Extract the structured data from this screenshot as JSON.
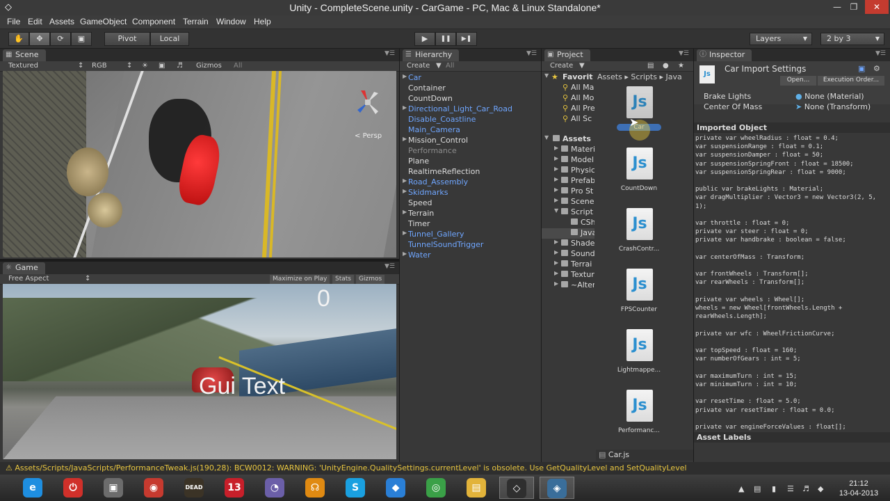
{
  "window": {
    "title": "Unity - CompleteScene.unity - CarGame - PC, Mac & Linux Standalone*",
    "controls": {
      "minimize": "—",
      "maximize": "❐",
      "close": "✕"
    }
  },
  "menu": [
    "File",
    "Edit",
    "Assets",
    "GameObject",
    "Component",
    "Terrain",
    "Window",
    "Help"
  ],
  "toolbar": {
    "transform_tools": [
      "hand-icon",
      "move-icon",
      "rotate-icon",
      "scale-icon"
    ],
    "pivot_label": "Pivot",
    "local_label": "Local",
    "play": "▶",
    "pause": "❚❚",
    "step": "▶❚",
    "layers_label": "Layers",
    "layout_label": "2 by 3"
  },
  "scene": {
    "tab_label": "Scene",
    "render_mode": "Textured",
    "color_mode": "RGB",
    "gizmos_label": "Gizmos",
    "search_placeholder": "All",
    "persp_label": "Persp"
  },
  "game": {
    "tab_label": "Game",
    "aspect": "Free Aspect",
    "maximize_label": "Maximize on Play",
    "stats_label": "Stats",
    "gizmos_label": "Gizmos",
    "score": "0",
    "gui_text": "Gui Text",
    "car_label": "Gui Text"
  },
  "hierarchy": {
    "tab_label": "Hierarchy",
    "create_label": "Create",
    "search_placeholder": "All",
    "items": [
      {
        "label": "Car",
        "kind": "prefab",
        "expandable": true
      },
      {
        "label": "Container",
        "kind": "normal",
        "expandable": false
      },
      {
        "label": "CountDown",
        "kind": "normal",
        "expandable": false
      },
      {
        "label": "Directional_Light_Car_Road",
        "kind": "prefab",
        "expandable": true
      },
      {
        "label": "Disable_Coastline",
        "kind": "prefab",
        "expandable": false
      },
      {
        "label": "Main_Camera",
        "kind": "prefab",
        "expandable": false
      },
      {
        "label": "Mission_Control",
        "kind": "normal",
        "expandable": true
      },
      {
        "label": "Performance",
        "kind": "dim",
        "expandable": false
      },
      {
        "label": "Plane",
        "kind": "normal",
        "expandable": false
      },
      {
        "label": "RealtimeReflection",
        "kind": "normal",
        "expandable": false
      },
      {
        "label": "Road_Assembly",
        "kind": "prefab",
        "expandable": true
      },
      {
        "label": "Skidmarks",
        "kind": "prefab",
        "expandable": true
      },
      {
        "label": "Speed",
        "kind": "normal",
        "expandable": false
      },
      {
        "label": "Terrain",
        "kind": "normal",
        "expandable": true
      },
      {
        "label": "Timer",
        "kind": "normal",
        "expandable": false
      },
      {
        "label": "Tunnel_Gallery",
        "kind": "prefab",
        "expandable": true
      },
      {
        "label": "TunnelSoundTrigger",
        "kind": "prefab",
        "expandable": false
      },
      {
        "label": "Water",
        "kind": "prefab",
        "expandable": true
      }
    ]
  },
  "project": {
    "tab_label": "Project",
    "create_label": "Create",
    "favorites_label": "Favorit",
    "favorites": [
      "All Ma",
      "All Mo",
      "All Pre",
      "All Sc"
    ],
    "assets_label": "Assets",
    "folders": [
      "Materi",
      "Model",
      "Physic",
      "Prefab",
      "Pro St",
      "Scene",
      "Script",
      "CSh",
      "Java",
      "Shade",
      "Sound",
      "Terrai",
      "Textur",
      "~Alter"
    ],
    "breadcrumb": [
      "Assets",
      "Scripts",
      "Java"
    ],
    "breadcrumb_sep": "▸",
    "assets": [
      "Car",
      "CountDown",
      "CrashContr...",
      "FPSCounter",
      "Lightmappe...",
      "Performanc..."
    ],
    "js_glyph": "Js",
    "selected_file": "Car.js"
  },
  "inspector": {
    "tab_label": "Inspector",
    "title": "Car Import Settings",
    "open_label": "Open...",
    "exec_order_label": "Execution Order...",
    "fields": [
      {
        "label": "Brake Lights",
        "value": "None (Material)"
      },
      {
        "label": "Center Of Mass",
        "value": "None (Transform)"
      }
    ],
    "imported_label": "Imported Object",
    "code": "private var wheelRadius : float = 0.4;\nvar suspensionRange : float = 0.1;\nvar suspensionDamper : float = 50;\nvar suspensionSpringFront : float = 18500;\nvar suspensionSpringRear : float = 9000;\n\npublic var brakeLights : Material;\nvar dragMultiplier : Vector3 = new Vector3(2, 5, 1);\n\nvar throttle : float = 0;\nprivate var steer : float = 0;\nprivate var handbrake : boolean = false;\n\nvar centerOfMass : Transform;\n\nvar frontWheels : Transform[];\nvar rearWheels : Transform[];\n\nprivate var wheels : Wheel[];\nwheels = new Wheel[frontWheels.Length + rearWheels.Length];\n\nprivate var wfc : WheelFrictionCurve;\n\nvar topSpeed : float = 160;\nvar numberOfGears : int = 5;\n\nvar maximumTurn : int = 15;\nvar minimumTurn : int = 10;\n\nvar resetTime : float = 5.0;\nprivate var resetTimer : float = 0.0;\n\nprivate var engineForceValues : float[];",
    "asset_labels": "Asset Labels"
  },
  "status": {
    "message": "Assets/Scripts/JavaScripts/PerformanceTweak.js(190,28): BCW0012: WARNING: 'UnityEngine.QualitySettings.currentLevel' is obsolete. Use GetQualityLevel and SetQualityLevel"
  },
  "taskbar": {
    "apps": [
      {
        "name": "internet-explorer-icon",
        "glyph": "e",
        "color": "#1e8ee0"
      },
      {
        "name": "shutdown-app-icon",
        "glyph": "⏻",
        "color": "#d0302a"
      },
      {
        "name": "computer-icon",
        "glyph": "▣",
        "color": "#6c6c6c"
      },
      {
        "name": "paint-app-icon",
        "glyph": "◉",
        "color": "#c63a2f"
      },
      {
        "name": "game-dead-icon",
        "glyph": "DEAD",
        "color": "#3b3326"
      },
      {
        "name": "b13-app-icon",
        "glyph": "13",
        "color": "#c81f2a"
      },
      {
        "name": "media-player-icon",
        "glyph": "◔",
        "color": "#6b5fa8"
      },
      {
        "name": "headphones-icon",
        "glyph": "☊",
        "color": "#e08a12"
      },
      {
        "name": "skype-icon",
        "glyph": "S",
        "color": "#1aa0e0"
      },
      {
        "name": "dropbox-icon",
        "glyph": "◆",
        "color": "#2a7fd6"
      },
      {
        "name": "chrome-icon",
        "glyph": "◎",
        "color": "#3aa047"
      },
      {
        "name": "file-explorer-icon",
        "glyph": "▤",
        "color": "#e2b33a"
      },
      {
        "name": "unity-icon",
        "glyph": "◇",
        "color": "#2f2f2f"
      },
      {
        "name": "unity-tools-icon",
        "glyph": "◈",
        "color": "#3a6e9a"
      }
    ],
    "time": "21:12",
    "date": "13-04-2013"
  }
}
